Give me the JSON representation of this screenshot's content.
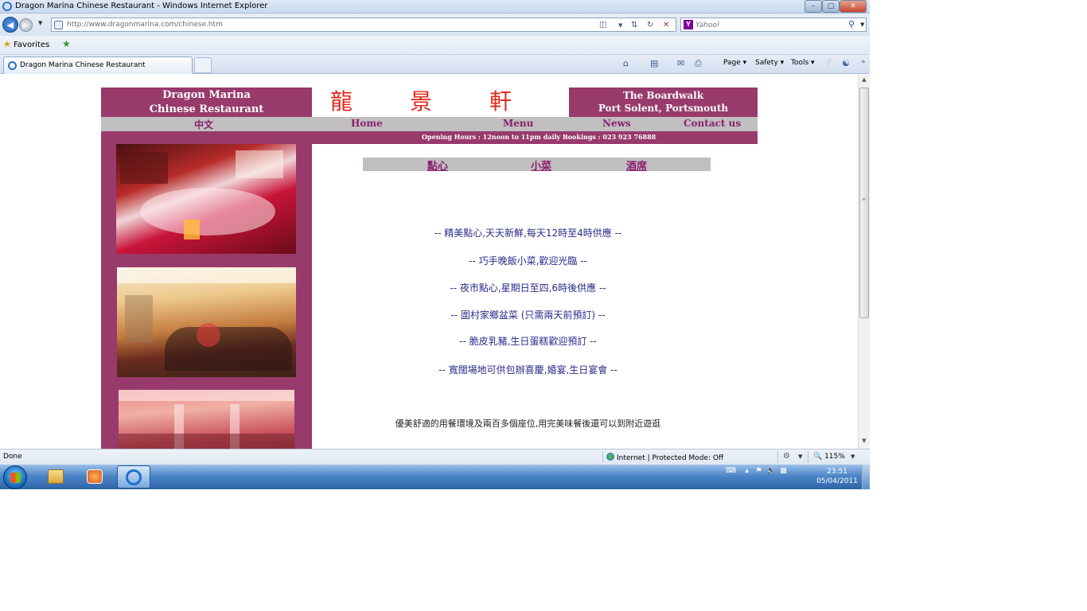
{
  "window": {
    "title": "Dragon Marina Chinese Restaurant - Windows Internet Explorer",
    "minimize": "–",
    "maximize": "□",
    "close": "✕"
  },
  "address_bar": {
    "url": "http://www.dragonmarina.com/chinese.htm",
    "search_placeholder": "Yahoo!"
  },
  "favorites_bar": {
    "favorites_label": "Favorites"
  },
  "tab": {
    "label": "Dragon Marina Chinese Restaurant"
  },
  "command_bar": {
    "page": "Page",
    "safety": "Safety",
    "tools": "Tools"
  },
  "site": {
    "header_left_line1": "Dragon Marina",
    "header_left_line2": "Chinese Restaurant",
    "header_chinese": [
      "龍",
      "景",
      "軒"
    ],
    "header_right_line1": "The Boardwalk",
    "header_right_line2": "Port Solent, Portsmouth",
    "nav": {
      "chinese": "中文",
      "home": "Home",
      "menu": "Menu",
      "news": "News",
      "contact": "Contact us"
    },
    "hours": "Opening Hours : 12noon to 11pm daily    Bookings : 023 923 76888",
    "subnav": [
      "點心",
      "小菜",
      "酒席"
    ],
    "promos": [
      "-- 精美點心,天天新鮮,每天12時至4時供應  --",
      "-- 巧手晚飯小菜,歡迎光臨 --",
      "-- 夜市點心,星期日至四,6時後供應  --",
      "-- 圍村家鄉盆菜 (只需兩天前預訂) --",
      "-- 脆皮乳豬,生日蛋糕歡迎預訂  --",
      "-- 寬闊場地可供包辦喜慶,婚宴,生日宴會  --"
    ],
    "body_text": "優美舒適的用餐環境及兩百多個座位,用完美味餐後還可以到附近遊逛"
  },
  "status_bar": {
    "status": "Done",
    "zone": "Internet | Protected Mode: Off",
    "zoom": "115%"
  },
  "taskbar": {
    "time": "23:51",
    "date": "05/04/2011"
  }
}
